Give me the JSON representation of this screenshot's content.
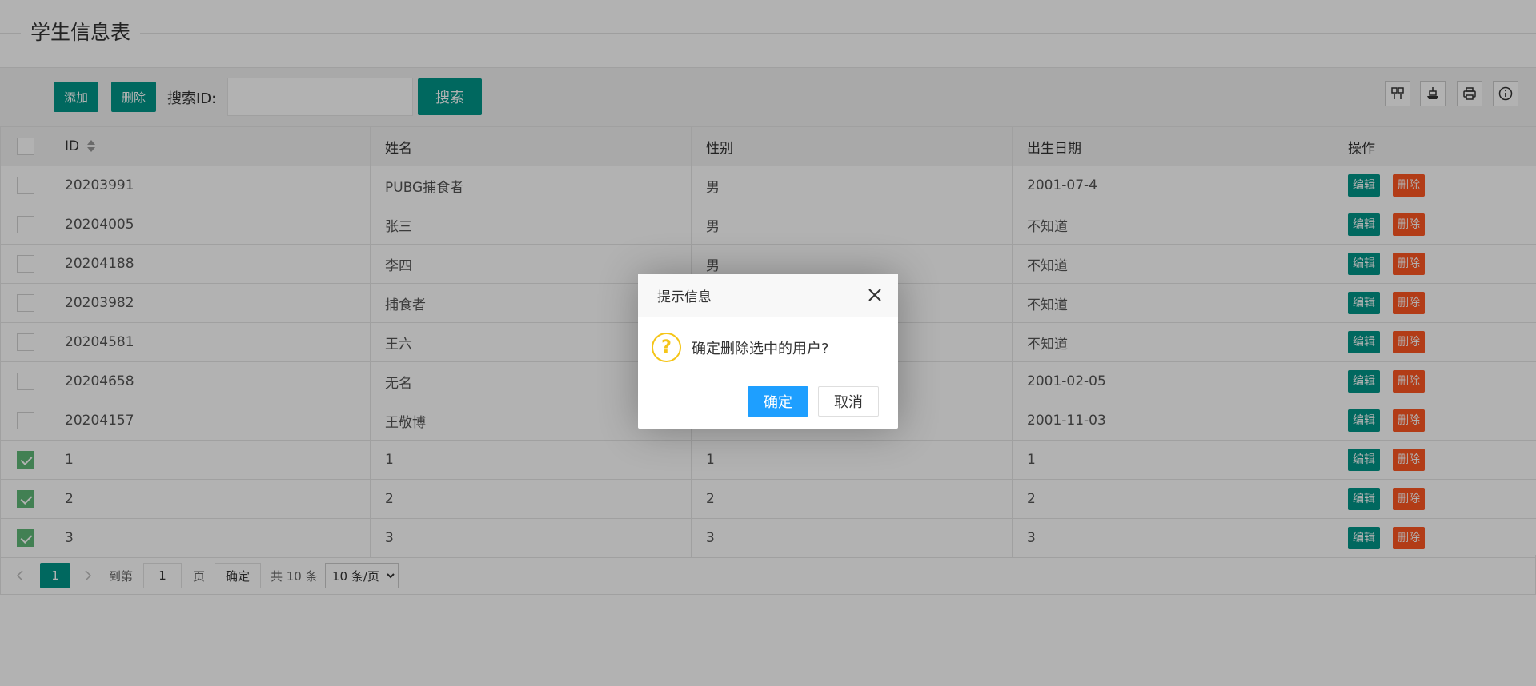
{
  "page": {
    "title": "学生信息表"
  },
  "toolbar": {
    "add_label": "添加",
    "delete_label": "删除",
    "search_label": "搜索ID:",
    "search_value": "",
    "search_placeholder": "",
    "search_button": "搜索"
  },
  "table": {
    "columns": [
      "ID",
      "姓名",
      "性别",
      "出生日期",
      "操作"
    ],
    "rows": [
      {
        "id": "20203991",
        "name": "PUBG捕食者",
        "gender": "男",
        "birth": "2001-07-4",
        "checked": false
      },
      {
        "id": "20204005",
        "name": "张三",
        "gender": "男",
        "birth": "不知道",
        "checked": false
      },
      {
        "id": "20204188",
        "name": "李四",
        "gender": "男",
        "birth": "不知道",
        "checked": false
      },
      {
        "id": "20203982",
        "name": "捕食者",
        "gender": "",
        "birth": "不知道",
        "checked": false
      },
      {
        "id": "20204581",
        "name": "王六",
        "gender": "",
        "birth": "不知道",
        "checked": false
      },
      {
        "id": "20204658",
        "name": "无名",
        "gender": "",
        "birth": "2001-02-05",
        "checked": false
      },
      {
        "id": "20204157",
        "name": "王敬博",
        "gender": "",
        "birth": "2001-11-03",
        "checked": false
      },
      {
        "id": "1",
        "name": "1",
        "gender": "1",
        "birth": "1",
        "checked": true
      },
      {
        "id": "2",
        "name": "2",
        "gender": "2",
        "birth": "2",
        "checked": true
      },
      {
        "id": "3",
        "name": "3",
        "gender": "3",
        "birth": "3",
        "checked": true
      }
    ],
    "edit_label": "编辑",
    "delete_label": "删除"
  },
  "pager": {
    "current_page": "1",
    "goto_label": "到第",
    "goto_value": "1",
    "page_unit": "页",
    "confirm_label": "确定",
    "total_label": "共 10 条",
    "page_size": "10 条/页"
  },
  "dialog": {
    "title": "提示信息",
    "message": "确定删除选中的用户?",
    "ok_label": "确定",
    "cancel_label": "取消"
  },
  "colors": {
    "primary": "#009688",
    "danger": "#FF5722",
    "dialog_ok": "#1E9FFF",
    "checked": "#5FB878",
    "question_icon": "#f5c518"
  },
  "icons": [
    "columns-icon",
    "export-icon",
    "print-icon",
    "info-icon",
    "question-icon",
    "close-icon",
    "sort-icon",
    "prev-page-icon",
    "next-page-icon"
  ]
}
